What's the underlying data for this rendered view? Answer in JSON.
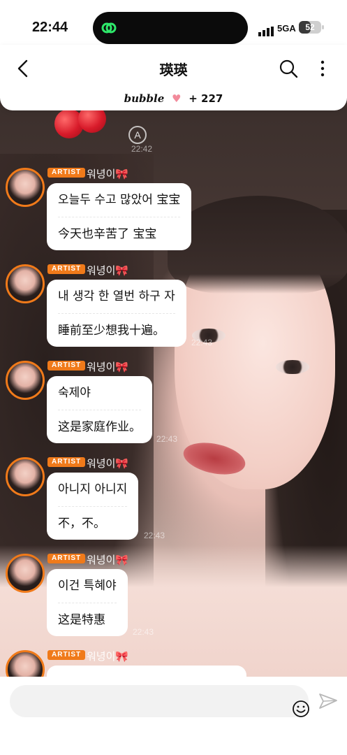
{
  "status_bar": {
    "time": "22:44",
    "network": "5GA",
    "battery": "52"
  },
  "header": {
    "title": "瑛瑛",
    "subtitle_brand": "bubble",
    "subtitle_count": "+ 227"
  },
  "background_times": [
    "22:42",
    "22:43",
    "22:43",
    "22:43",
    "22:43"
  ],
  "messages": [
    {
      "badge": "ARTIST",
      "sender": "워녕이🎀",
      "lines": [
        "오늘두 수고 많았어 宝宝",
        "今天也辛苦了 宝宝"
      ]
    },
    {
      "badge": "ARTIST",
      "sender": "워녕이🎀",
      "lines": [
        "내 생각 한 열번 하구 자",
        "睡前至少想我十遍。"
      ]
    },
    {
      "badge": "ARTIST",
      "sender": "워녕이🎀",
      "lines": [
        "숙제야",
        "这是家庭作业。"
      ]
    },
    {
      "badge": "ARTIST",
      "sender": "워녕이🎀",
      "lines": [
        "아니지 아니지",
        "不，不。"
      ]
    },
    {
      "badge": "ARTIST",
      "sender": "워녕이🎀",
      "lines": [
        "이건 특혜야",
        "这是特惠"
      ]
    },
    {
      "badge": "ARTIST",
      "sender": "워녕이🎀",
      "lines": []
    }
  ],
  "icons": {
    "back": "chevron-left-icon",
    "search": "search-icon",
    "more": "more-vertical-icon",
    "emoji": "smiley-icon",
    "send": "send-icon"
  },
  "colors": {
    "accent": "#f07a1a",
    "bubble_bg": "#ffffff"
  }
}
